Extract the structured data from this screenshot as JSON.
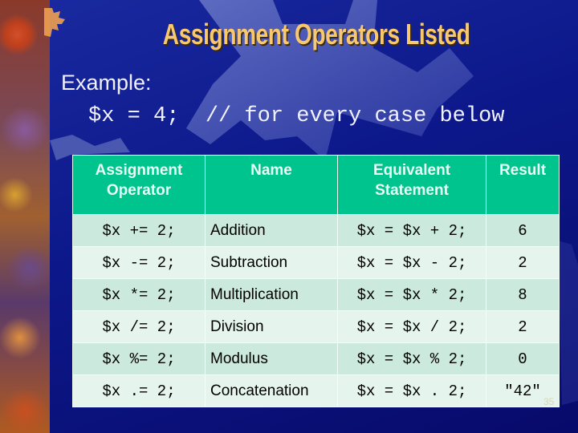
{
  "slide": {
    "title": "Assignment Operators Listed",
    "example_label": "Example:",
    "example_code": "$x = 4;  // for every case below",
    "page_number": "35"
  },
  "colors": {
    "title": "#f8c870",
    "header_bg": "#00c48e",
    "row_odd_bg": "#cce9dd",
    "row_even_bg": "#e6f4ee",
    "background": "#0c188a"
  },
  "table": {
    "headers": [
      "Assignment Operator",
      "Name",
      "Equivalent Statement",
      "Result"
    ],
    "rows": [
      {
        "operator": "$x += 2;",
        "name": "Addition",
        "equivalent": "$x = $x + 2;",
        "result": "6"
      },
      {
        "operator": "$x -= 2;",
        "name": "Subtraction",
        "equivalent": "$x = $x - 2;",
        "result": "2"
      },
      {
        "operator": "$x *= 2;",
        "name": "Multiplication",
        "equivalent": "$x = $x * 2;",
        "result": "8"
      },
      {
        "operator": "$x /= 2;",
        "name": "Division",
        "equivalent": "$x = $x / 2;",
        "result": "2"
      },
      {
        "operator": "$x %= 2;",
        "name": "Modulus",
        "equivalent": "$x = $x % 2;",
        "result": "0"
      },
      {
        "operator": "$x .= 2;",
        "name": "Concatenation",
        "equivalent": "$x = $x . 2;",
        "result": "\"42\""
      }
    ]
  }
}
